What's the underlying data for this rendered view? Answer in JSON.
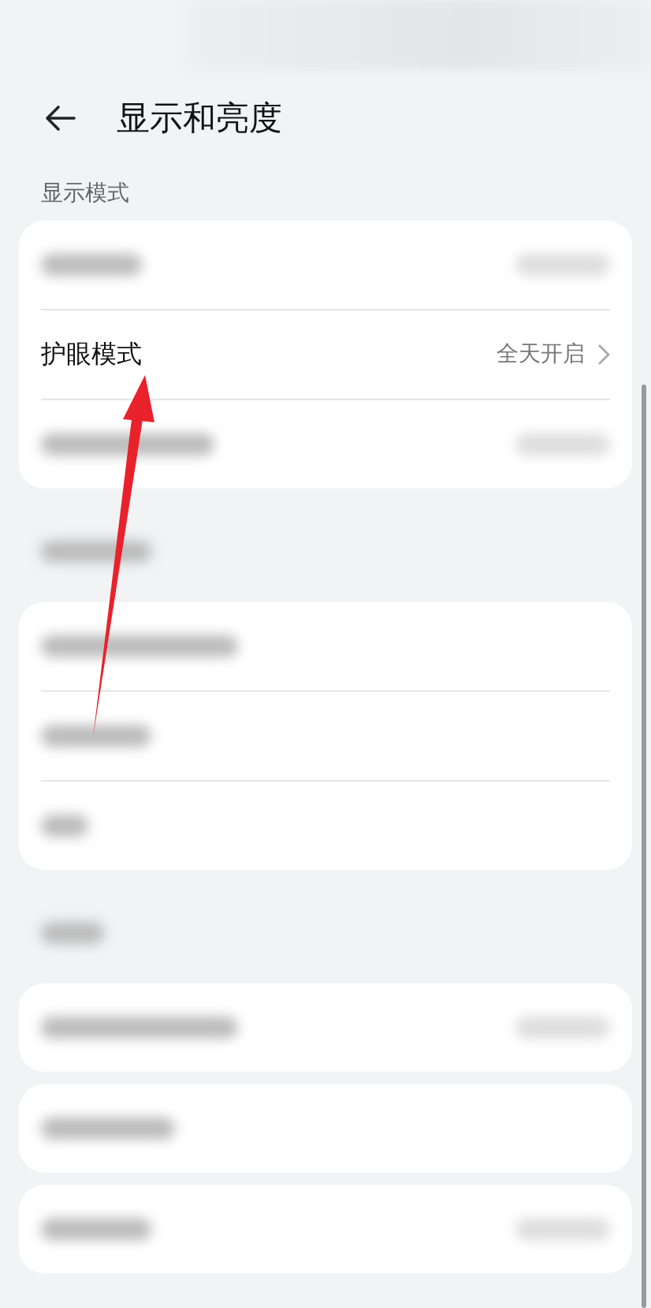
{
  "header": {
    "title": "显示和亮度"
  },
  "sections": [
    {
      "header": {
        "kind": "text",
        "label": "显示模式"
      },
      "cards": [
        {
          "rows": [
            {
              "kind": "blurred",
              "trailing": true
            },
            {
              "kind": "text",
              "label": "护眼模式",
              "value": "全天开启"
            },
            {
              "kind": "blurred",
              "trailing": true
            }
          ]
        }
      ]
    },
    {
      "header": {
        "kind": "blurred"
      },
      "cards": [
        {
          "rows": [
            {
              "kind": "blurred",
              "trailing": false
            },
            {
              "kind": "blurred",
              "trailing": false
            },
            {
              "kind": "blurred",
              "trailing": false
            }
          ]
        }
      ]
    },
    {
      "header": {
        "kind": "blurred"
      },
      "cards": [
        {
          "rows": [
            {
              "kind": "blurred",
              "trailing": true
            }
          ]
        },
        {
          "rows": [
            {
              "kind": "blurred",
              "trailing": false
            }
          ]
        },
        {
          "rows": [
            {
              "kind": "blurred",
              "trailing": true
            }
          ]
        }
      ]
    }
  ]
}
